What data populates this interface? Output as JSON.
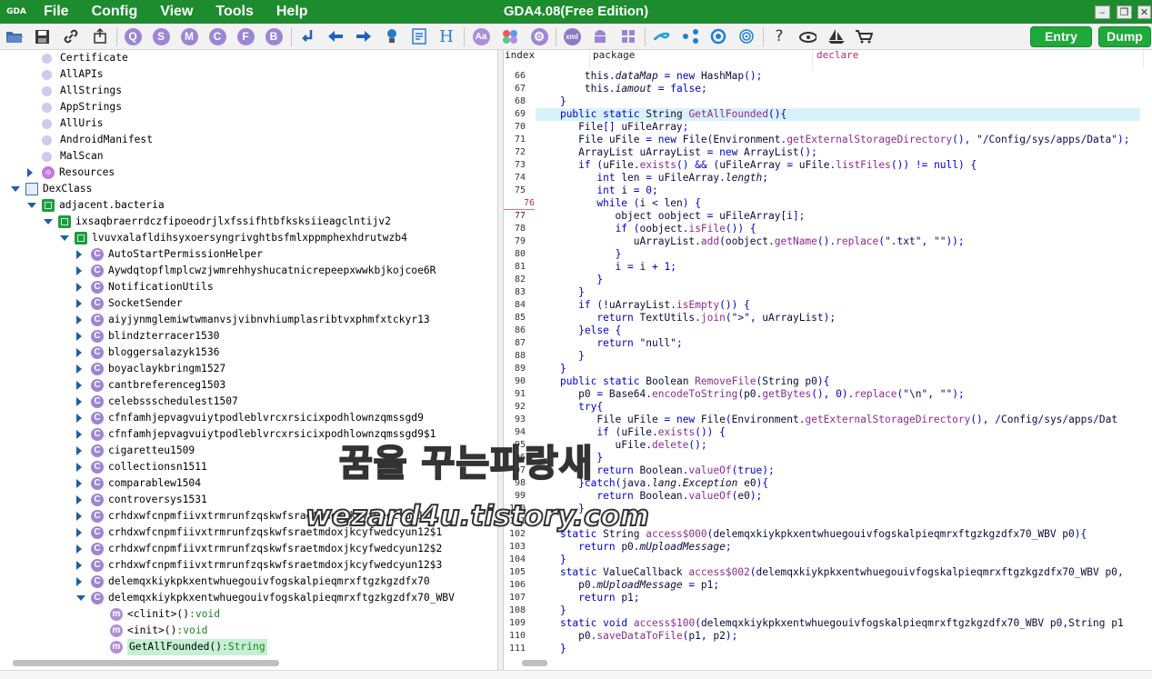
{
  "app": {
    "logo_text": "GDA",
    "title": "GDA4.08(Free Edition)"
  },
  "menus": [
    "File",
    "Config",
    "View",
    "Tools",
    "Help"
  ],
  "window_buttons": {
    "minimize": "–",
    "maximize": "❐",
    "close": "✕"
  },
  "toolbar": {
    "letters": [
      "Q",
      "S",
      "M",
      "C",
      "F",
      "B"
    ],
    "entry_label": "Entry",
    "dump_label": "Dump",
    "help_glyph": "?",
    "xml_label": "xml",
    "h_glyph": "H",
    "aa_glyph": "Aa"
  },
  "colors": {
    "title_green": "#1c8c2e",
    "button_green": "#1fa83b",
    "icon_purple": "#9c86d4",
    "keyword_blue": "#0000d0",
    "method_purple": "#8d2b8f"
  },
  "tree": [
    {
      "label": "Certificate",
      "type": "dot",
      "level": 2
    },
    {
      "label": "AllAPIs",
      "type": "dot",
      "level": 2
    },
    {
      "label": "AllStrings",
      "type": "dot",
      "level": 2
    },
    {
      "label": "AppStrings",
      "type": "dot",
      "level": 2
    },
    {
      "label": "AllUris",
      "type": "dot",
      "level": 2
    },
    {
      "label": "AndroidManifest",
      "type": "dot",
      "level": 2
    },
    {
      "label": "MalScan",
      "type": "dot",
      "level": 2
    },
    {
      "label": "Resources",
      "type": "resource",
      "level": 1,
      "expand": "r"
    },
    {
      "label": "DexClass",
      "type": "dex",
      "level": 0,
      "expand": "d"
    },
    {
      "label": "adjacent.bacteria",
      "type": "pkg",
      "level": 1,
      "expand": "d"
    },
    {
      "label": "ixsaqbraerrdczfipoeodrjlxfssifhtbfksksiieagclntijv2",
      "type": "pkg",
      "level": 2,
      "expand": "d"
    },
    {
      "label": "lvuvxalafldihsyxoersyngrivghtbsfmlxppmphexhdrutwzb4",
      "type": "pkg",
      "level": 3,
      "expand": "d"
    },
    {
      "label": "AutoStartPermissionHelper",
      "type": "class",
      "level": 4,
      "expand": "r"
    },
    {
      "label": "Aywdqtopflmplcwzjwmrehhyshucatnicrepeepxwwkbjkojcoe6R",
      "type": "class",
      "level": 4,
      "expand": "r"
    },
    {
      "label": "NotificationUtils",
      "type": "class",
      "level": 4,
      "expand": "r"
    },
    {
      "label": "SocketSender",
      "type": "class",
      "level": 4,
      "expand": "r"
    },
    {
      "label": "aiyjynmglemiwtwmanvsjvibnvhiumplasribtvxphmfxtckyr13",
      "type": "class",
      "level": 4,
      "expand": "r"
    },
    {
      "label": "blindzterracer1530",
      "type": "class",
      "level": 4,
      "expand": "r"
    },
    {
      "label": "bloggersalazyk1536",
      "type": "class",
      "level": 4,
      "expand": "r"
    },
    {
      "label": "boyaclaykbringm1527",
      "type": "class",
      "level": 4,
      "expand": "r"
    },
    {
      "label": "cantbreferenceg1503",
      "type": "class",
      "level": 4,
      "expand": "r"
    },
    {
      "label": "celebssschedulest1507",
      "type": "class",
      "level": 4,
      "expand": "r"
    },
    {
      "label": "cfnfamhjepvagvuiytpodleblvrcxrsicixpodhlownzqmssgd9",
      "type": "class",
      "level": 4,
      "expand": "r"
    },
    {
      "label": "cfnfamhjepvagvuiytpodleblvrcxrsicixpodhlownzqmssgd9$1",
      "type": "class",
      "level": 4,
      "expand": "r"
    },
    {
      "label": "cigaretteu1509",
      "type": "class",
      "level": 4,
      "expand": "r"
    },
    {
      "label": "collectionsn1511",
      "type": "class",
      "level": 4,
      "expand": "r"
    },
    {
      "label": "comparablew1504",
      "type": "class",
      "level": 4,
      "expand": "r"
    },
    {
      "label": "controversys1531",
      "type": "class",
      "level": 4,
      "expand": "r"
    },
    {
      "label": "crhdxwfcnpmfiivxtrmrunfzqskwfsraetmdoxjkcyfwedcyun12",
      "type": "class",
      "level": 4,
      "expand": "r"
    },
    {
      "label": "crhdxwfcnpmfiivxtrmrunfzqskwfsraetmdoxjkcyfwedcyun12$1",
      "type": "class",
      "level": 4,
      "expand": "r"
    },
    {
      "label": "crhdxwfcnpmfiivxtrmrunfzqskwfsraetmdoxjkcyfwedcyun12$2",
      "type": "class",
      "level": 4,
      "expand": "r"
    },
    {
      "label": "crhdxwfcnpmfiivxtrmrunfzqskwfsraetmdoxjkcyfwedcyun12$3",
      "type": "class",
      "level": 4,
      "expand": "r"
    },
    {
      "label": "delemqxkiykpkxentwhuegouivfogskalpieqmrxftgzkgzdfx70",
      "type": "class",
      "level": 4,
      "expand": "r"
    },
    {
      "label": "delemqxkiykpkxentwhuegouivfogskalpieqmrxftgzkgzdfx70_WBV",
      "type": "class",
      "level": 4,
      "expand": "d"
    },
    {
      "label": "<clinit>()",
      "suffix": ":void",
      "type": "method",
      "level": 5
    },
    {
      "label": "<init>()",
      "suffix": ":void",
      "type": "method",
      "level": 5
    },
    {
      "label": "GetAllFounded()",
      "suffix": ":String",
      "type": "method",
      "level": 5,
      "selected": true
    }
  ],
  "columns": [
    "index",
    "package",
    "declare"
  ],
  "code": [
    {
      "n": "66",
      "t": "        this.dataMap = new HashMap();"
    },
    {
      "n": "67",
      "t": "        this.iamout = false;"
    },
    {
      "n": "68",
      "t": "    }"
    },
    {
      "n": "69",
      "t": "    public static String GetAllFounded(){",
      "hl": true
    },
    {
      "n": "70",
      "t": "       File[] uFileArray;"
    },
    {
      "n": "71",
      "t": "       File uFile = new File(Environment.getExternalStorageDirectory(), \"/Config/sys/apps/Data\");"
    },
    {
      "n": "72",
      "t": "       ArrayList uArrayList = new ArrayList();"
    },
    {
      "n": "73",
      "t": "       if (uFile.exists() && (uFileArray = uFile.listFiles()) != null) {"
    },
    {
      "n": "74",
      "t": "          int len = uFileArray.length;"
    },
    {
      "n": "75",
      "t": "          int i = 0;"
    },
    {
      "n": "76",
      "t": "          while (i < len) {",
      "mark": true
    },
    {
      "n": "77",
      "t": "             object oobject = uFileArray[i];"
    },
    {
      "n": "78",
      "t": "             if (oobject.isFile()) {"
    },
    {
      "n": "79",
      "t": "                uArrayList.add(oobject.getName().replace(\".txt\", \"\"));"
    },
    {
      "n": "80",
      "t": "             }"
    },
    {
      "n": "81",
      "t": "             i = i + 1;"
    },
    {
      "n": "82",
      "t": "          }"
    },
    {
      "n": "83",
      "t": "       }"
    },
    {
      "n": "84",
      "t": "       if (!uArrayList.isEmpty()) {"
    },
    {
      "n": "85",
      "t": "          return TextUtils.join(\">\", uArrayList);"
    },
    {
      "n": "86",
      "t": "       }else {"
    },
    {
      "n": "87",
      "t": "          return \"null\";"
    },
    {
      "n": "88",
      "t": "       }"
    },
    {
      "n": "89",
      "t": "    }"
    },
    {
      "n": "90",
      "t": "    public static Boolean RemoveFile(String p0){"
    },
    {
      "n": "91",
      "t": "       p0 = Base64.encodeToString(p0.getBytes(), 0).replace(\"\\n\", \"\");"
    },
    {
      "n": "92",
      "t": "       try{"
    },
    {
      "n": "93",
      "t": "          File uFile = new File(Environment.getExternalStorageDirectory(), \"/Config/sys/apps/Dat"
    },
    {
      "n": "94",
      "t": "          if (uFile.exists()) {"
    },
    {
      "n": "95",
      "t": "             uFile.delete();"
    },
    {
      "n": "96",
      "t": "          }"
    },
    {
      "n": "97",
      "t": "          return Boolean.valueOf(true);"
    },
    {
      "n": "98",
      "t": "       }catch(java.lang.Exception e0){"
    },
    {
      "n": "99",
      "t": "          return Boolean.valueOf(e0);"
    },
    {
      "n": "100",
      "t": "       }"
    },
    {
      "n": "101",
      "t": "    }"
    },
    {
      "n": "102",
      "t": "    static String access$000(delemqxkiykpkxentwhuegouivfogskalpieqmrxftgzkgzdfx70_WBV p0){"
    },
    {
      "n": "103",
      "t": "       return p0.mUploadMessage;"
    },
    {
      "n": "104",
      "t": "    }"
    },
    {
      "n": "105",
      "t": "    static ValueCallback access$002(delemqxkiykpkxentwhuegouivfogskalpieqmrxftgzkgzdfx70_WBV p0,"
    },
    {
      "n": "106",
      "t": "       p0.mUploadMessage = p1;"
    },
    {
      "n": "107",
      "t": "       return p1;"
    },
    {
      "n": "108",
      "t": "    }"
    },
    {
      "n": "109",
      "t": "    static void access$100(delemqxkiykpkxentwhuegouivfogskalpieqmrxftgzkgzdfx70_WBV p0,String p1"
    },
    {
      "n": "110",
      "t": "       p0.saveDataToFile(p1, p2);"
    },
    {
      "n": "111",
      "t": "    }"
    }
  ],
  "watermark": {
    "line1": "꿈을 꾸는파랑새",
    "line2": "wezard4u.tistory.com"
  }
}
